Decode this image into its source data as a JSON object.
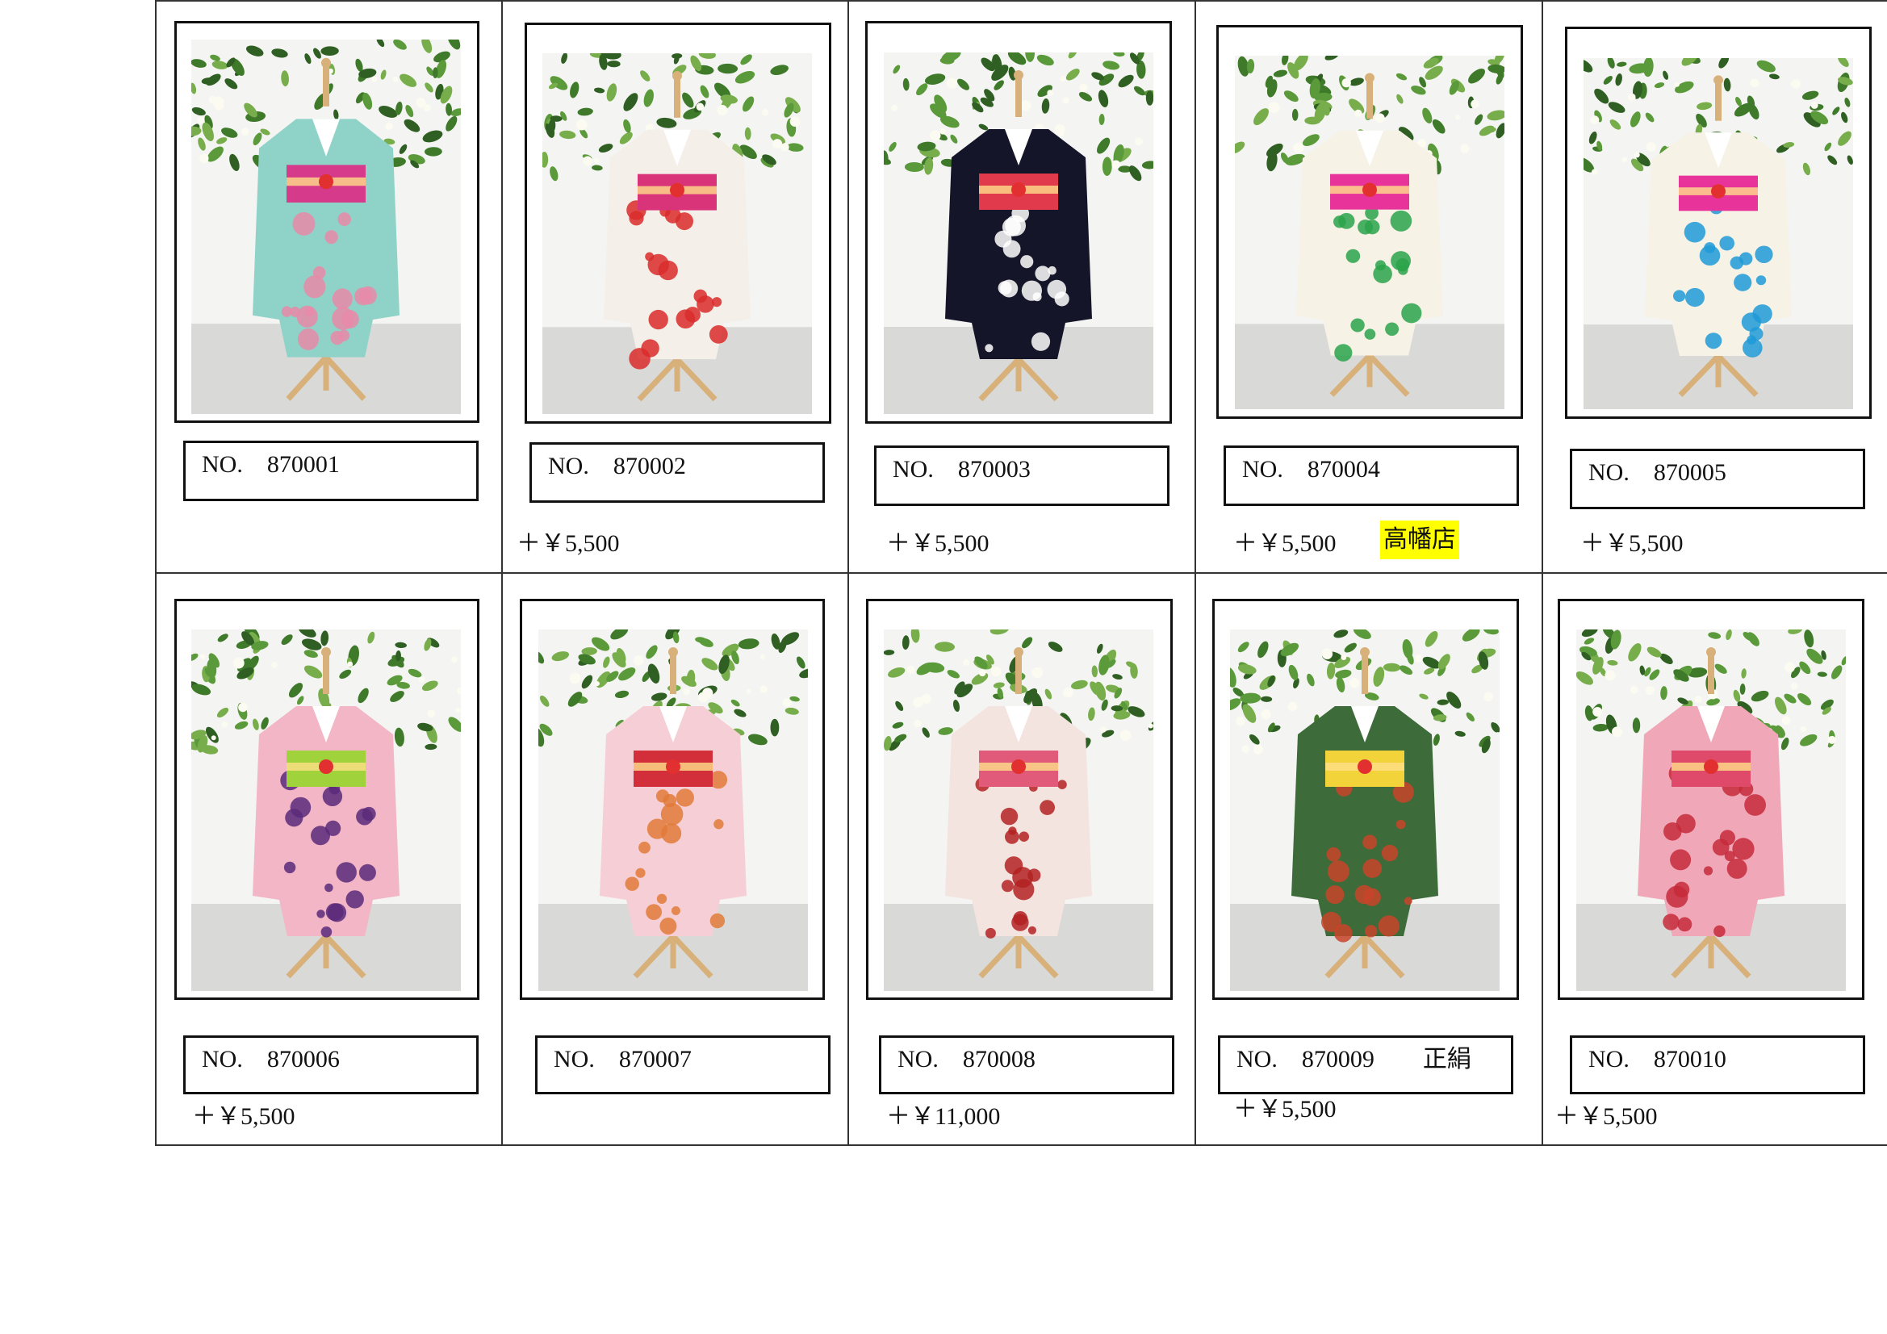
{
  "items": [
    {
      "no": "NO.　870001",
      "price": "",
      "extra": "",
      "store": "",
      "colors": {
        "body": "#8fd3c8",
        "obi": "#d63a8a",
        "accent": "#e88aa8"
      }
    },
    {
      "no": "NO.　870002",
      "price": "＋￥5,500",
      "extra": "",
      "store": "",
      "colors": {
        "body": "#f4efe8",
        "obi": "#d9347a",
        "accent": "#d92b2b"
      }
    },
    {
      "no": "NO.　870003",
      "price": "＋￥5,500",
      "extra": "",
      "store": "",
      "colors": {
        "body": "#15152a",
        "obi": "#e23a4d",
        "accent": "#ffffff"
      }
    },
    {
      "no": "NO.　870004",
      "price": "＋￥5,500",
      "extra": "",
      "store": "高幡店",
      "colors": {
        "body": "#f7f2e6",
        "obi": "#e8339a",
        "accent": "#2aa34a"
      }
    },
    {
      "no": "NO.　870005",
      "price": "＋￥5,500",
      "extra": "",
      "store": "",
      "colors": {
        "body": "#f7f2e6",
        "obi": "#e8339a",
        "accent": "#1e9ad6"
      }
    },
    {
      "no": "NO.　870006",
      "price": "＋￥5,500",
      "extra": "",
      "store": "",
      "colors": {
        "body": "#f2b6c6",
        "obi": "#9fd23b",
        "accent": "#5a2a7a"
      }
    },
    {
      "no": "NO.　870007",
      "price": "",
      "extra": "",
      "store": "",
      "colors": {
        "body": "#f6cfd6",
        "obi": "#d32f3a",
        "accent": "#e07a3a"
      }
    },
    {
      "no": "NO.　870008",
      "price": "＋￥11,000",
      "extra": "",
      "store": "",
      "colors": {
        "body": "#f3e4e0",
        "obi": "#e15a7a",
        "accent": "#b32222"
      }
    },
    {
      "no": "NO.　870009",
      "price": "＋￥5,500",
      "extra": "正絹",
      "store": "",
      "colors": {
        "body": "#3d6b3a",
        "obi": "#f2d33a",
        "accent": "#c8442a"
      }
    },
    {
      "no": "NO.　870010",
      "price": "＋￥5,500",
      "extra": "",
      "store": "",
      "colors": {
        "body": "#f0a8b8",
        "obi": "#e04a6a",
        "accent": "#c62a3a"
      }
    }
  ]
}
